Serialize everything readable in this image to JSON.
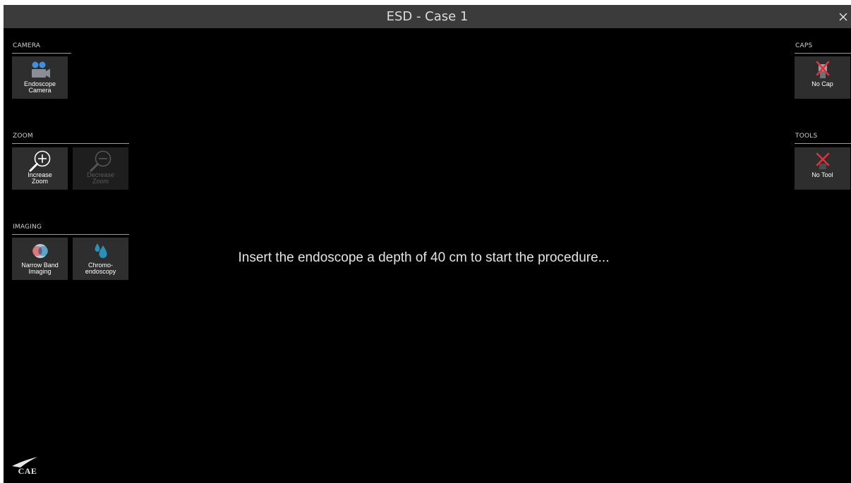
{
  "window": {
    "title": "ESD - Case 1",
    "close_glyph": "×"
  },
  "left_panel": {
    "camera": {
      "label": "CAMERA",
      "buttons": [
        {
          "label": "Endoscope\nCamera",
          "icon": "video-camera-icon"
        }
      ]
    },
    "zoom": {
      "label": "ZOOM",
      "buttons": [
        {
          "label": "Increase\nZoom",
          "icon": "zoom-in-icon",
          "enabled": true
        },
        {
          "label": "Decrease\nZoom",
          "icon": "zoom-out-icon",
          "enabled": false
        }
      ]
    },
    "imaging": {
      "label": "IMAGING",
      "buttons": [
        {
          "label": "Narrow Band\nImaging",
          "icon": "narrow-band-imaging-icon"
        },
        {
          "label": "Chromo-\nendoscopy",
          "icon": "dye-drops-icon"
        }
      ]
    }
  },
  "right_panel": {
    "caps": {
      "label": "CAPS",
      "buttons": [
        {
          "label": "No Cap",
          "icon": "no-cap-icon"
        }
      ]
    },
    "tools": {
      "label": "TOOLS",
      "buttons": [
        {
          "label": "No Tool",
          "icon": "no-tool-icon"
        }
      ]
    }
  },
  "main": {
    "message": "Insert the endoscope a depth of 40 cm to start the procedure..."
  },
  "branding": {
    "logo_text": "CAE"
  },
  "colors": {
    "background": "#000000",
    "titlebar": "#3b3b3b",
    "tile": "#2e2e2e",
    "camera_blue": "#3d8fe0",
    "drop_blue": "#2c8fb7",
    "no_red": "#e0303a"
  }
}
